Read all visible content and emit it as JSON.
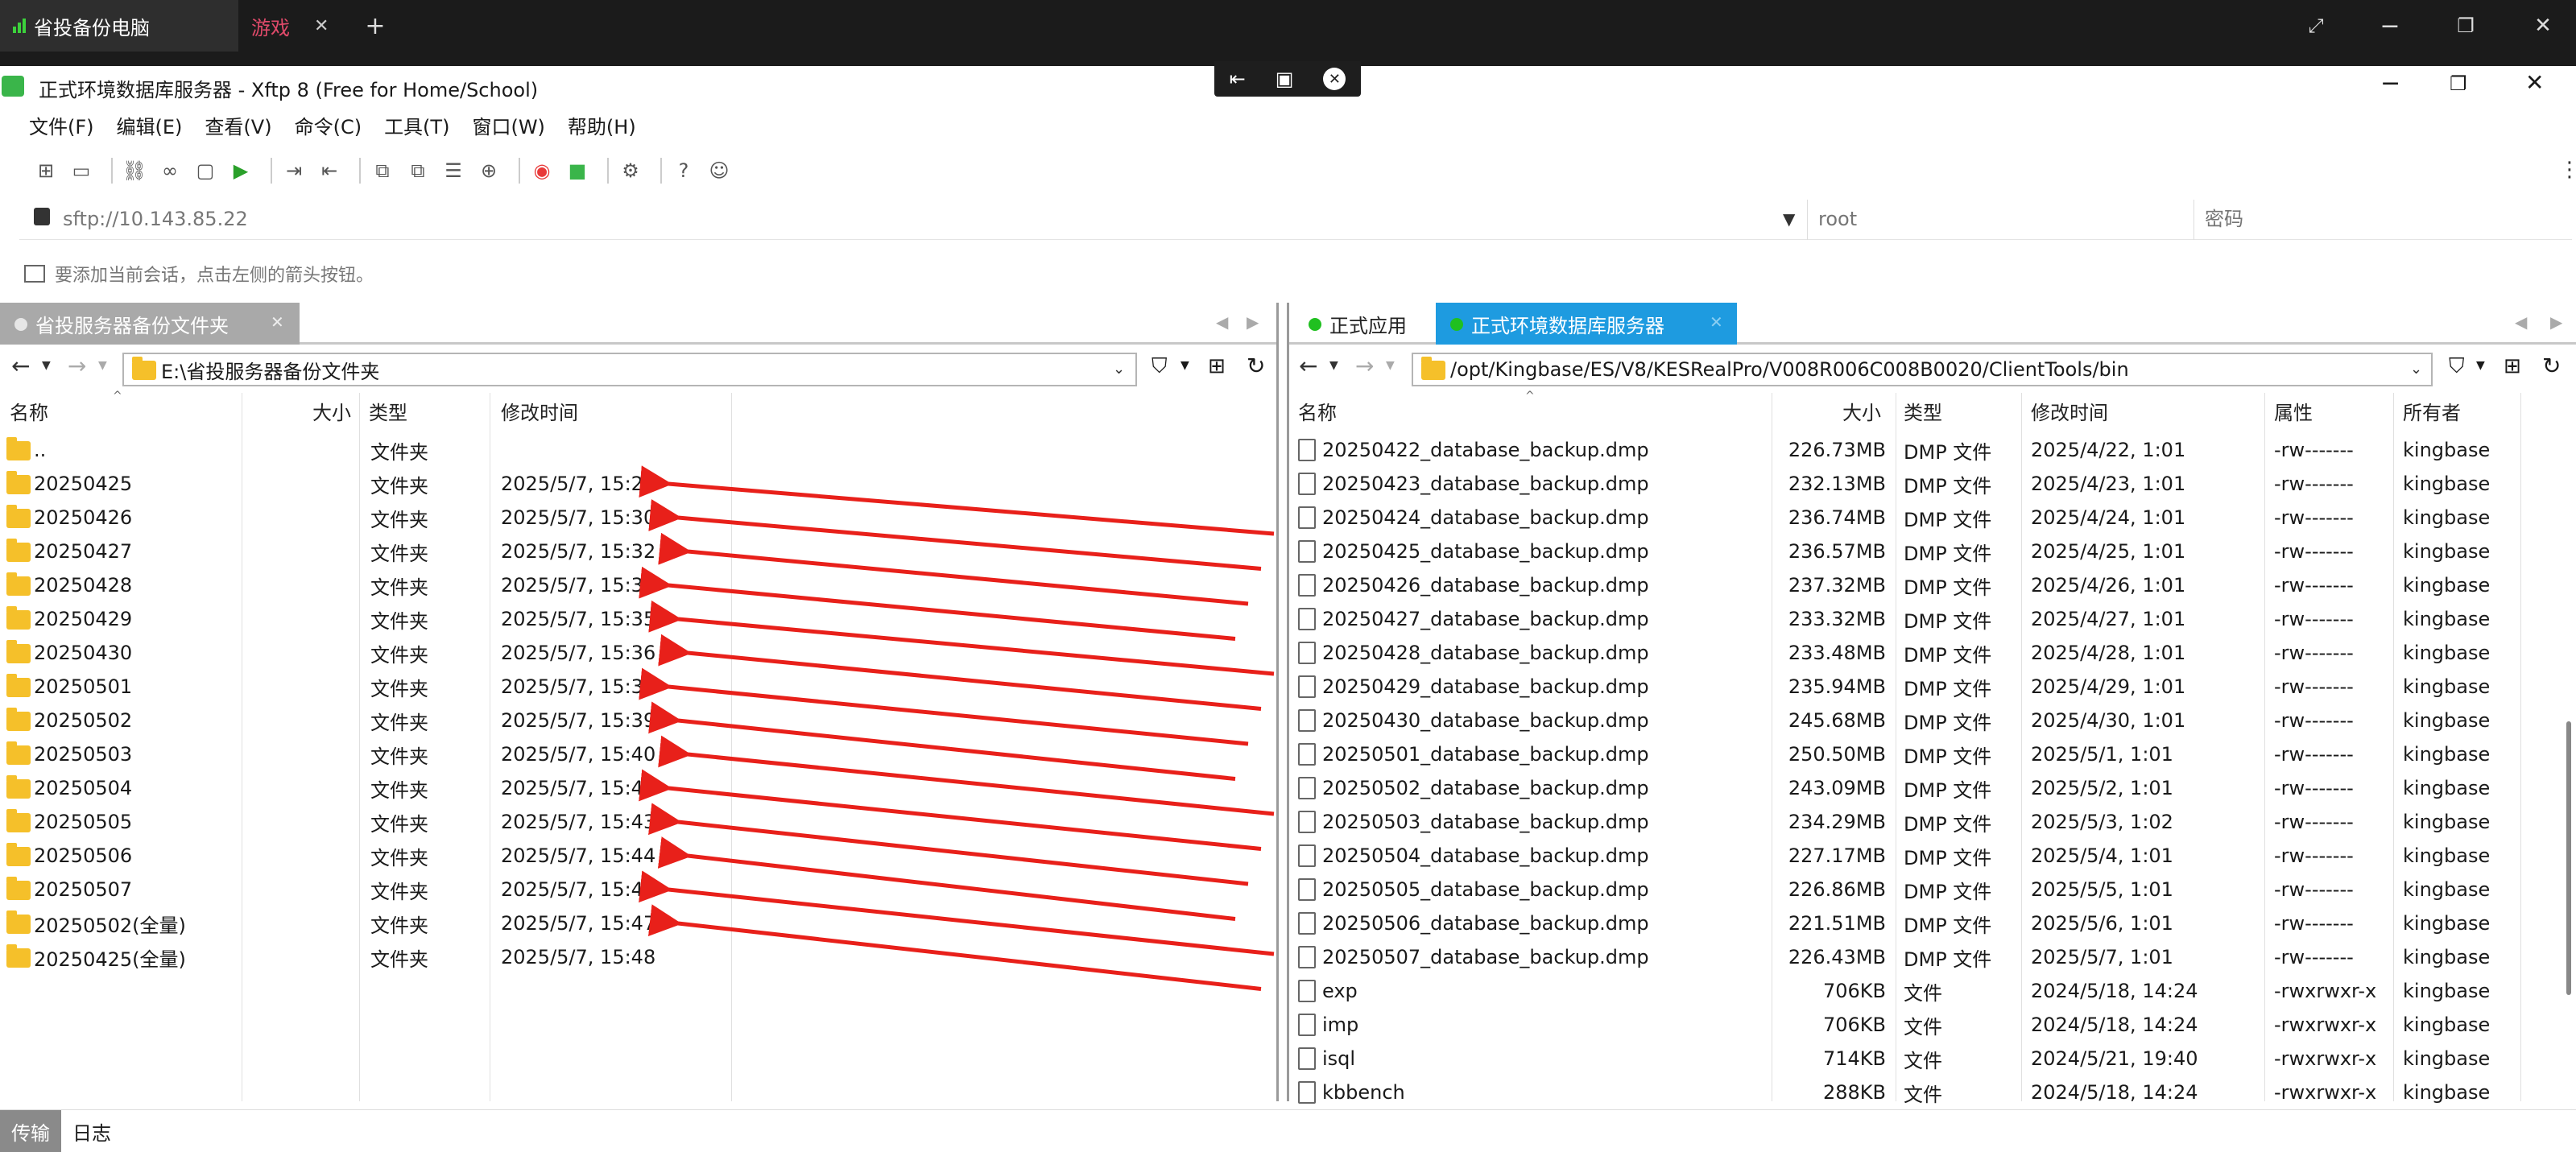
{
  "rd": {
    "tab1_label": "省投备份电脑",
    "tab2_label": "游戏",
    "close_glyph": "✕",
    "new_tab_glyph": "+"
  },
  "window": {
    "title": "正式环境数据库服务器 - Xftp 8 (Free for Home/School)"
  },
  "menu": [
    "文件(F)",
    "编辑(E)",
    "查看(V)",
    "命令(C)",
    "工具(T)",
    "窗口(W)",
    "帮助(H)"
  ],
  "address": {
    "url": "sftp://10.143.85.22",
    "user_placeholder": "root",
    "password_placeholder": "密码"
  },
  "hint": "要添加当前会话，点击左侧的箭头按钮。",
  "left": {
    "tab_label": "省投服务器备份文件夹",
    "path": "E:\\省投服务器备份文件夹",
    "headers": {
      "name": "名称",
      "size": "大小",
      "type": "类型",
      "mtime": "修改时间"
    },
    "rows": [
      {
        "name": "..",
        "type": "文件夹",
        "mtime": ""
      },
      {
        "name": "20250425",
        "type": "文件夹",
        "mtime": "2025/5/7, 15:28"
      },
      {
        "name": "20250426",
        "type": "文件夹",
        "mtime": "2025/5/7, 15:30"
      },
      {
        "name": "20250427",
        "type": "文件夹",
        "mtime": "2025/5/7, 15:32"
      },
      {
        "name": "20250428",
        "type": "文件夹",
        "mtime": "2025/5/7, 15:33"
      },
      {
        "name": "20250429",
        "type": "文件夹",
        "mtime": "2025/5/7, 15:35"
      },
      {
        "name": "20250430",
        "type": "文件夹",
        "mtime": "2025/5/7, 15:36"
      },
      {
        "name": "20250501",
        "type": "文件夹",
        "mtime": "2025/5/7, 15:38"
      },
      {
        "name": "20250502",
        "type": "文件夹",
        "mtime": "2025/5/7, 15:39"
      },
      {
        "name": "20250503",
        "type": "文件夹",
        "mtime": "2025/5/7, 15:40"
      },
      {
        "name": "20250504",
        "type": "文件夹",
        "mtime": "2025/5/7, 15:41"
      },
      {
        "name": "20250505",
        "type": "文件夹",
        "mtime": "2025/5/7, 15:43"
      },
      {
        "name": "20250506",
        "type": "文件夹",
        "mtime": "2025/5/7, 15:44"
      },
      {
        "name": "20250507",
        "type": "文件夹",
        "mtime": "2025/5/7, 15:45"
      },
      {
        "name": "20250502(全量)",
        "type": "文件夹",
        "mtime": "2025/5/7, 15:47"
      },
      {
        "name": "20250425(全量)",
        "type": "文件夹",
        "mtime": "2025/5/7, 15:48"
      }
    ]
  },
  "right": {
    "tab1_label": "正式应用",
    "tab2_label": "正式环境数据库服务器",
    "path": "/opt/Kingbase/ES/V8/KESRealPro/V008R006C008B0020/ClientTools/bin",
    "headers": {
      "name": "名称",
      "size": "大小",
      "type": "类型",
      "mtime": "修改时间",
      "attr": "属性",
      "owner": "所有者"
    },
    "rows": [
      {
        "name": "20250422_database_backup.dmp",
        "size": "226.73MB",
        "type": "DMP 文件",
        "mtime": "2025/4/22, 1:01",
        "attr": "-rw-------",
        "owner": "kingbase"
      },
      {
        "name": "20250423_database_backup.dmp",
        "size": "232.13MB",
        "type": "DMP 文件",
        "mtime": "2025/4/23, 1:01",
        "attr": "-rw-------",
        "owner": "kingbase"
      },
      {
        "name": "20250424_database_backup.dmp",
        "size": "236.74MB",
        "type": "DMP 文件",
        "mtime": "2025/4/24, 1:01",
        "attr": "-rw-------",
        "owner": "kingbase"
      },
      {
        "name": "20250425_database_backup.dmp",
        "size": "236.57MB",
        "type": "DMP 文件",
        "mtime": "2025/4/25, 1:01",
        "attr": "-rw-------",
        "owner": "kingbase"
      },
      {
        "name": "20250426_database_backup.dmp",
        "size": "237.32MB",
        "type": "DMP 文件",
        "mtime": "2025/4/26, 1:01",
        "attr": "-rw-------",
        "owner": "kingbase"
      },
      {
        "name": "20250427_database_backup.dmp",
        "size": "233.32MB",
        "type": "DMP 文件",
        "mtime": "2025/4/27, 1:01",
        "attr": "-rw-------",
        "owner": "kingbase"
      },
      {
        "name": "20250428_database_backup.dmp",
        "size": "233.48MB",
        "type": "DMP 文件",
        "mtime": "2025/4/28, 1:01",
        "attr": "-rw-------",
        "owner": "kingbase"
      },
      {
        "name": "20250429_database_backup.dmp",
        "size": "235.94MB",
        "type": "DMP 文件",
        "mtime": "2025/4/29, 1:01",
        "attr": "-rw-------",
        "owner": "kingbase"
      },
      {
        "name": "20250430_database_backup.dmp",
        "size": "245.68MB",
        "type": "DMP 文件",
        "mtime": "2025/4/30, 1:01",
        "attr": "-rw-------",
        "owner": "kingbase"
      },
      {
        "name": "20250501_database_backup.dmp",
        "size": "250.50MB",
        "type": "DMP 文件",
        "mtime": "2025/5/1, 1:01",
        "attr": "-rw-------",
        "owner": "kingbase"
      },
      {
        "name": "20250502_database_backup.dmp",
        "size": "243.09MB",
        "type": "DMP 文件",
        "mtime": "2025/5/2, 1:01",
        "attr": "-rw-------",
        "owner": "kingbase"
      },
      {
        "name": "20250503_database_backup.dmp",
        "size": "234.29MB",
        "type": "DMP 文件",
        "mtime": "2025/5/3, 1:02",
        "attr": "-rw-------",
        "owner": "kingbase"
      },
      {
        "name": "20250504_database_backup.dmp",
        "size": "227.17MB",
        "type": "DMP 文件",
        "mtime": "2025/5/4, 1:01",
        "attr": "-rw-------",
        "owner": "kingbase"
      },
      {
        "name": "20250505_database_backup.dmp",
        "size": "226.86MB",
        "type": "DMP 文件",
        "mtime": "2025/5/5, 1:01",
        "attr": "-rw-------",
        "owner": "kingbase"
      },
      {
        "name": "20250506_database_backup.dmp",
        "size": "221.51MB",
        "type": "DMP 文件",
        "mtime": "2025/5/6, 1:01",
        "attr": "-rw-------",
        "owner": "kingbase"
      },
      {
        "name": "20250507_database_backup.dmp",
        "size": "226.43MB",
        "type": "DMP 文件",
        "mtime": "2025/5/7, 1:01",
        "attr": "-rw-------",
        "owner": "kingbase"
      },
      {
        "name": "exp",
        "size": "706KB",
        "type": "文件",
        "mtime": "2024/5/18, 14:24",
        "attr": "-rwxrwxr-x",
        "owner": "kingbase"
      },
      {
        "name": "imp",
        "size": "706KB",
        "type": "文件",
        "mtime": "2024/5/18, 14:24",
        "attr": "-rwxrwxr-x",
        "owner": "kingbase"
      },
      {
        "name": "isql",
        "size": "714KB",
        "type": "文件",
        "mtime": "2024/5/21, 19:40",
        "attr": "-rwxrwxr-x",
        "owner": "kingbase"
      },
      {
        "name": "kbbench",
        "size": "288KB",
        "type": "文件",
        "mtime": "2024/5/18, 14:24",
        "attr": "-rwxrwxr-x",
        "owner": "kingbase"
      }
    ]
  },
  "bottom": {
    "transfer_label": "传输",
    "log_label": "日志"
  },
  "colors": {
    "accent": "#1e9be0",
    "arrow": "#e8201a",
    "online": "#20c020"
  }
}
